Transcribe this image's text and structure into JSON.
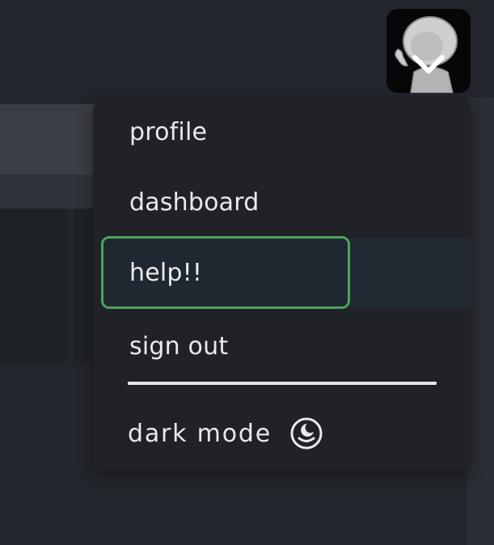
{
  "account_menu": {
    "avatar_icon": "user-avatar-with-chevron-down-icon",
    "items": [
      {
        "label": "profile"
      },
      {
        "label": "dashboard"
      },
      {
        "label": "help!!"
      },
      {
        "label": "sign out"
      }
    ],
    "active_item_index": 2,
    "dark_mode": {
      "label": "dark mode",
      "icon": "moon-clock-icon"
    }
  },
  "colors": {
    "background": "#22252b",
    "menu_bg": "#202227",
    "text": "#e9eaec",
    "active_border": "#4aa35c"
  }
}
